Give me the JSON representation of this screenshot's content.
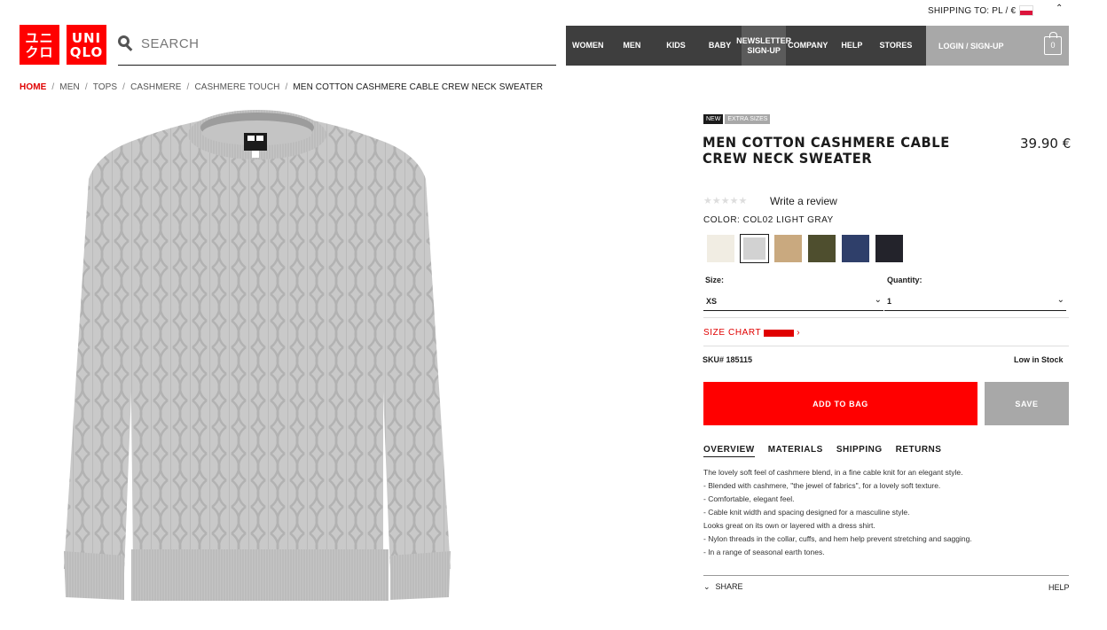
{
  "header": {
    "shipping_label": "SHIPPING TO: PL / €",
    "logo_top": "ユニ\nクロ",
    "logo_brand": "UNI\nQLO",
    "search_placeholder": "SEARCH",
    "nav": [
      "WOMEN",
      "MEN",
      "KIDS",
      "BABY",
      "NEWSLETTER SIGN-UP",
      "COMPANY",
      "HELP",
      "STORES"
    ],
    "login": "LOGIN / SIGN-UP",
    "bag_count": "0"
  },
  "breadcrumb": {
    "items": [
      "HOME",
      "MEN",
      "TOPS",
      "CASHMERE",
      "CASHMERE TOUCH",
      "MEN COTTON CASHMERE CABLE CREW NECK SWEATER"
    ],
    "separator": "/"
  },
  "product": {
    "badge_new": "NEW",
    "badge_extra": "EXTRA SIZES",
    "title": "MEN COTTON CASHMERE CABLE CREW NECK SWEATER",
    "price": "39.90 €",
    "stars": "★★★★★",
    "rating": 0,
    "review_link": "Write a review",
    "color_label": "COLOR: COL02 LIGHT GRAY",
    "swatches": [
      "#f1ede3",
      "#d2d2d2",
      "#c9a97f",
      "#4e4e2e",
      "#2f3f6a",
      "#23232b"
    ],
    "selected_swatch": 1,
    "size_label": "Size:",
    "size_value": "XS",
    "qty_label": "Quantity:",
    "qty_value": "1",
    "size_chart": "SIZE CHART",
    "sku": "SKU# 185115",
    "stock": "Low in Stock",
    "add_to_bag": "ADD TO BAG",
    "save": "SAVE",
    "accent": "#ff0000"
  },
  "tabs": [
    "OVERVIEW",
    "MATERIALS",
    "SHIPPING",
    "RETURNS"
  ],
  "description": [
    "The lovely soft feel of cashmere blend, in a fine cable knit for an elegant style.",
    "- Blended with cashmere, \"the jewel of fabrics\", for a lovely soft texture.",
    "- Comfortable, elegant feel.",
    "- Cable knit width and spacing designed for a masculine style.",
    "Looks great on its own or layered with a dress shirt.",
    "- Nylon threads in the collar, cuffs, and hem help prevent stretching and sagging.",
    "- In a range of seasonal earth tones."
  ],
  "footer": {
    "share": "SHARE",
    "help": "HELP"
  }
}
